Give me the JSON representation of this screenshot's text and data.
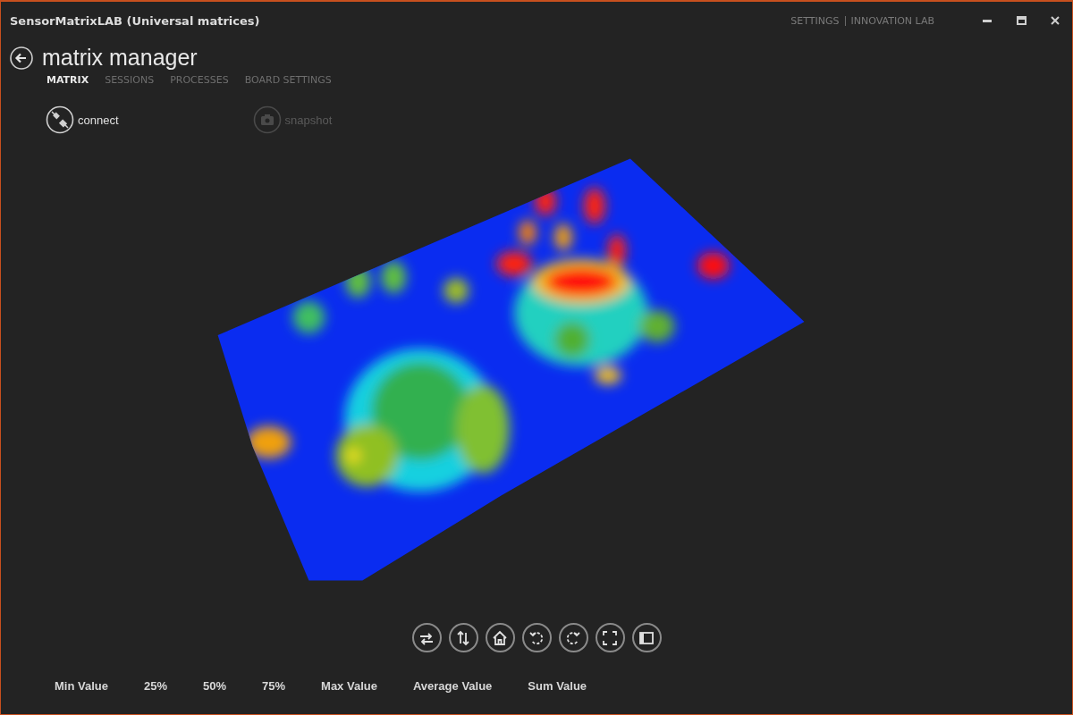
{
  "window": {
    "title": "SensorMatrixLAB (Universal matrices)",
    "links": [
      "SETTINGS",
      "INNOVATION LAB"
    ]
  },
  "header": {
    "title": "matrix manager"
  },
  "tabs": [
    {
      "label": "MATRIX",
      "selected": true
    },
    {
      "label": "SESSIONS",
      "selected": false
    },
    {
      "label": "PROCESSES",
      "selected": false
    },
    {
      "label": "BOARD SETTINGS",
      "selected": false
    }
  ],
  "actions": [
    {
      "label": "connect",
      "kind": "connect",
      "disabled": false
    },
    {
      "label": "snapshot",
      "kind": "camera",
      "disabled": true
    }
  ],
  "view_tools": [
    {
      "kind": "swap-horizontal"
    },
    {
      "kind": "swap-vertical"
    },
    {
      "kind": "home"
    },
    {
      "kind": "rotate-left"
    },
    {
      "kind": "rotate-right"
    },
    {
      "kind": "fit"
    },
    {
      "kind": "panel"
    }
  ],
  "stats": [
    "Min Value",
    "25%",
    "50%",
    "75%",
    "Max Value",
    "Average Value",
    "Sum Value"
  ]
}
